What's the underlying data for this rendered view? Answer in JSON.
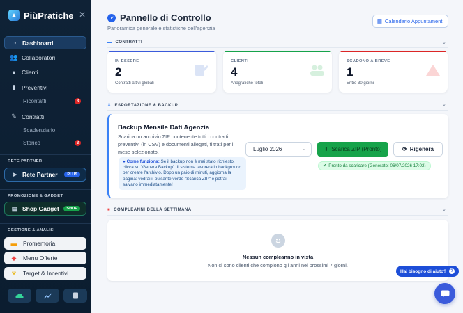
{
  "sidebar": {
    "brand": "PiùPratiche",
    "nav": [
      {
        "label": "Dashboard",
        "icon": "gauge-icon",
        "active": true
      },
      {
        "label": "Collaboratori",
        "icon": "users-icon"
      },
      {
        "label": "Clienti",
        "icon": "user-icon"
      },
      {
        "label": "Preventivi",
        "icon": "clipboard-icon"
      },
      {
        "label": "Ricontatti",
        "sub": true,
        "badge": "3"
      },
      {
        "label": "Contratti",
        "icon": "file-signature-icon"
      },
      {
        "label": "Scadenziario",
        "sub": true
      },
      {
        "label": "Storico",
        "sub": true,
        "badge": "3"
      }
    ],
    "section_partner": "RETE PARTNER",
    "partner_button": {
      "label": "Rete Partner",
      "badge": "PLUS"
    },
    "section_gadget": "PROMOZIONE & GADGET",
    "gadget_button": {
      "label": "Shop Gadget",
      "badge": "SHOP"
    },
    "section_tools": "GESTIONE & ANALISI",
    "tools": [
      {
        "label": "Promemoria",
        "icon": "note-icon",
        "color": "#f59e0b"
      },
      {
        "label": "Menu Offerte",
        "icon": "tag-icon",
        "color": "#ef4444"
      },
      {
        "label": "Target & Incentivi",
        "icon": "trophy-icon",
        "color": "#eab308"
      }
    ]
  },
  "header": {
    "title": "Pannello di Controllo",
    "subtitle": "Panoramica generale e statistiche dell'agenzia",
    "calendar_button": "Calendario Appuntamenti"
  },
  "contracts_section": {
    "label": "CONTRATTI",
    "kpis": [
      {
        "label": "IN ESSERE",
        "value": "2",
        "desc": "Contratti attivi globali",
        "color": "#3b5bdb"
      },
      {
        "label": "CLIENTI",
        "value": "4",
        "desc": "Anagrafiche totali",
        "color": "#16a34a"
      },
      {
        "label": "SCADONO A BREVE",
        "value": "1",
        "desc": "Entro 30 giorni",
        "color": "#dc2626"
      }
    ]
  },
  "backup_section": {
    "label": "ESPORTAZIONE & BACKUP",
    "title": "Backup Mensile Dati Agenzia",
    "description": "Scarica un archivio ZIP contenente tutti i contratti, preventivi (in CSV) e documenti allegati, filtrati per il mese selezionato.",
    "info_bold": "Come funziona:",
    "info_text": " Se il backup non è mai stato richiesto, clicca su \"Genera Backup\". Il sistema lavorerà in background per creare l'archivio. Dopo un paio di minuti, aggiorna la pagina: vedrai il pulsante verde \"Scarica ZIP\" e potrai salvarlo immediatamente!",
    "selected_month": "Luglio 2026",
    "download_button": "Scarica ZIP (Pronto)",
    "regen_button": "Rigenera",
    "ready_status": "Pronto da scaricare (Generato: 06/07/2026 17:02)"
  },
  "birthdays_section": {
    "label": "COMPLEANNI DELLA SETTIMANA",
    "empty_title": "Nessun compleanno in vista",
    "empty_text": "Non ci sono clienti che compiono gli anni nei prossimi 7 giorni."
  },
  "help": {
    "label": "Hai bisogno di aiuto?"
  }
}
